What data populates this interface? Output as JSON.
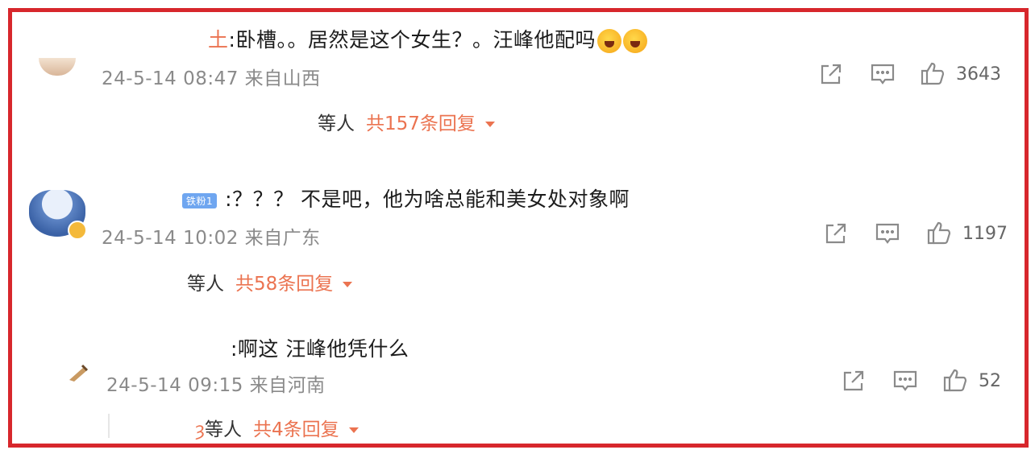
{
  "comments": [
    {
      "name_fragment": "土",
      "text": ":卧槽。。居然是这个女生？。汪峰他配吗",
      "meta": "24-5-14 08:47 来自山西",
      "likes": "3643",
      "reply_who": "等人",
      "reply_total": "共157条回复"
    },
    {
      "badge": "铁粉1",
      "text": ":？？？ 不是吧，他为啥总能和美女处对象啊",
      "meta": "24-5-14 10:02 来自广东",
      "likes": "1197",
      "reply_who": "等人",
      "reply_total": "共58条回复"
    },
    {
      "text": ":啊这 汪峰他凭什么",
      "meta": "24-5-14 09:15 来自河南",
      "likes": "52",
      "reply_prefix": "ȝ",
      "reply_who": "等人",
      "reply_total": "共4条回复"
    }
  ],
  "icons": {
    "share": "share-icon",
    "comment": "comment-icon",
    "like": "thumbs-up-icon"
  },
  "colors": {
    "frame": "#d7272c",
    "accent": "#eb7350",
    "meta": "#8a8a8a"
  }
}
